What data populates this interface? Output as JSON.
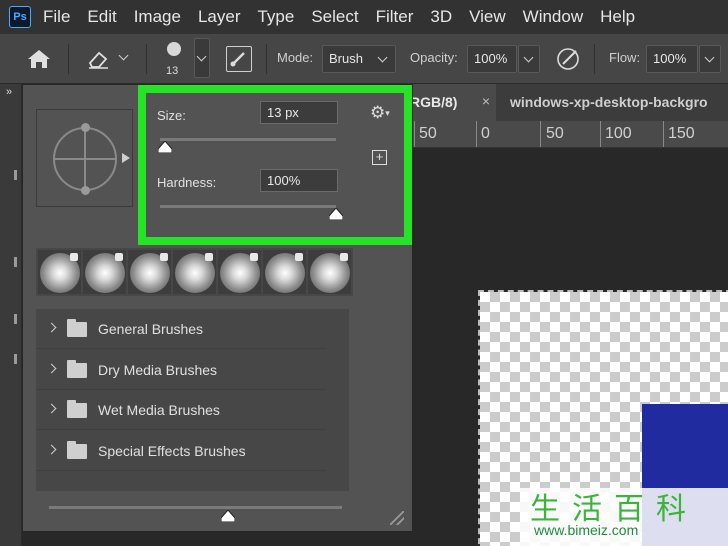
{
  "menubar": {
    "logo": "Ps",
    "items": [
      "File",
      "Edit",
      "Image",
      "Layer",
      "Type",
      "Select",
      "Filter",
      "3D",
      "View",
      "Window",
      "Help"
    ]
  },
  "options_bar": {
    "brush_size_readout": "13",
    "mode_label": "Mode:",
    "mode_value": "Brush",
    "opacity_label": "Opacity:",
    "opacity_value": "100%",
    "flow_label": "Flow:",
    "flow_value": "100%"
  },
  "tabs": {
    "active_tab": "RGB/8)",
    "close_glyph": "×",
    "second_tab": "windows-xp-desktop-backgro"
  },
  "ruler": {
    "ticks": [
      "50",
      "0",
      "50",
      "100",
      "150"
    ]
  },
  "brush_panel": {
    "size_label": "Size:",
    "size_value": "13 px",
    "size_fraction": 0.03,
    "hardness_label": "Hardness:",
    "hardness_value": "100%",
    "hardness_fraction": 1.0,
    "folders": [
      "General Brushes",
      "Dry Media Brushes",
      "Wet Media Brushes",
      "Special Effects Brushes"
    ]
  },
  "watermark": {
    "text": "生活百科",
    "url": "www.bimeiz.com"
  },
  "colors": {
    "highlight": "#27e327",
    "panel_bg": "#535353",
    "menubar_bg": "#323232",
    "canvas_blue": "#1f2b9f"
  }
}
